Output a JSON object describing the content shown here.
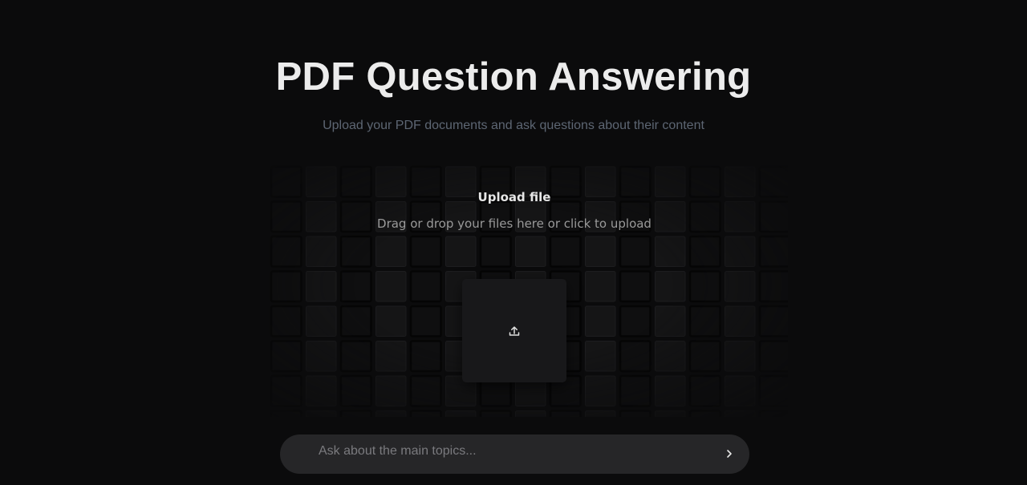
{
  "header": {
    "title": "PDF Question Answering",
    "subtitle": "Upload your PDF documents and ask questions about their content"
  },
  "upload": {
    "title": "Upload file",
    "description": "Drag or drop your files here or click to upload",
    "icon": "upload-icon"
  },
  "query": {
    "placeholder": "Ask about the main topics...",
    "value": "",
    "send_icon": "chevron-right-icon"
  },
  "colors": {
    "background": "#0b0b0c",
    "title": "#ececec",
    "subtitle": "#5d6673",
    "input_background": "#262628"
  }
}
